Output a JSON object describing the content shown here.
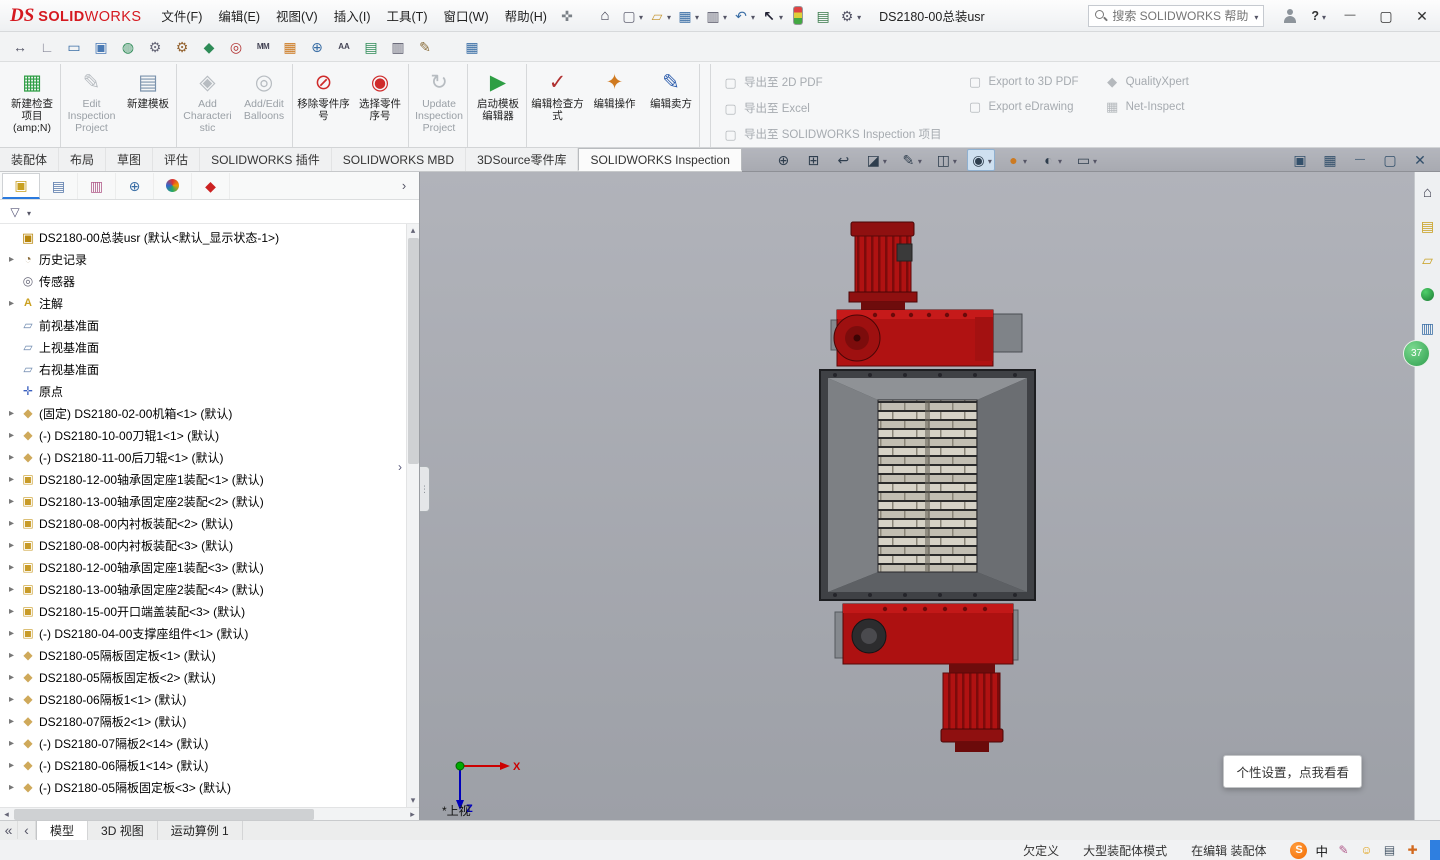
{
  "titlebar": {
    "brand": {
      "logo_text": "DS",
      "name_strong": "SOLID",
      "name_light": "WORKS"
    },
    "menus": [
      {
        "label": "文件(F)"
      },
      {
        "label": "编辑(E)"
      },
      {
        "label": "视图(V)"
      },
      {
        "label": "插入(I)"
      },
      {
        "label": "工具(T)"
      },
      {
        "label": "窗口(W)"
      },
      {
        "label": "帮助(H)"
      }
    ],
    "doc_title": "DS2180-00总装usr",
    "search_placeholder": "搜索 SOLIDWORKS 帮助",
    "help_label": "?"
  },
  "qat": {
    "items": [
      {
        "icon": "home-icon"
      },
      {
        "icon": "new-document-icon",
        "dropdown": true
      },
      {
        "icon": "open-icon",
        "dropdown": true
      },
      {
        "icon": "save-icon",
        "dropdown": true
      },
      {
        "icon": "print-icon",
        "dropdown": true
      },
      {
        "icon": "undo-icon",
        "dropdown": true
      },
      {
        "icon": "select-arrow-icon",
        "dropdown": true
      },
      {
        "icon": "performance-icon"
      },
      {
        "icon": "task-list-icon"
      },
      {
        "icon": "options-icon",
        "dropdown": true
      }
    ]
  },
  "window_controls": {
    "items": [
      {
        "icon": "minimize-icon"
      },
      {
        "icon": "maximize-icon"
      },
      {
        "icon": "close-icon"
      }
    ]
  },
  "toolbar2": {
    "items": [
      {
        "icon": "callout-icon"
      },
      {
        "icon": "ruler-icon"
      },
      {
        "icon": "monitor-icon"
      },
      {
        "icon": "capture-icon"
      },
      {
        "icon": "globe-icon"
      },
      {
        "icon": "gear-icon"
      },
      {
        "icon": "addins-gear-icon"
      },
      {
        "icon": "shield-icon"
      },
      {
        "icon": "target-icon"
      },
      {
        "icon": "units-icon"
      },
      {
        "icon": "palette-icon"
      },
      {
        "icon": "zoom-tool-icon"
      },
      {
        "icon": "fonts-icon"
      },
      {
        "icon": "doc-export-icon"
      },
      {
        "icon": "printer-icon"
      },
      {
        "icon": "doc-edit-icon"
      },
      {
        "icon": "grid-icon",
        "gap": true
      }
    ]
  },
  "ribbon": {
    "buttons": [
      {
        "label": "新建检查项目(amp;N)",
        "icon": "new-inspection-project-icon",
        "enabled": true,
        "sep": true
      },
      {
        "label": "Edit Inspection Project",
        "icon": "edit-inspection-project-icon",
        "enabled": false
      },
      {
        "label": "新建模板",
        "icon": "new-template-icon",
        "enabled": true,
        "sep": true
      },
      {
        "label": "Add Characteristic",
        "icon": "add-characteristic-icon",
        "enabled": false
      },
      {
        "label": "Add/Edit Balloons",
        "icon": "add-edit-balloons-icon",
        "enabled": false,
        "sep": true
      },
      {
        "label": "移除零件序号",
        "icon": "remove-balloons-icon",
        "enabled": true
      },
      {
        "label": "选择零件序号",
        "icon": "select-balloons-icon",
        "enabled": true,
        "sep": true
      },
      {
        "label": "Update Inspection Project",
        "icon": "update-inspection-project-icon",
        "enabled": false,
        "sep": true
      },
      {
        "label": "启动模板编辑器",
        "icon": "launch-template-editor-icon",
        "enabled": true,
        "sep": true
      },
      {
        "label": "编辑检查方式",
        "icon": "edit-inspection-method-icon",
        "enabled": true
      },
      {
        "label": "编辑操作",
        "icon": "edit-operation-icon",
        "enabled": true
      },
      {
        "label": "编辑卖方",
        "icon": "edit-vendor-icon",
        "enabled": true,
        "sep": true
      }
    ],
    "export_col1": [
      {
        "label": "导出至 2D PDF",
        "icon": "export-2d-pdf-icon"
      },
      {
        "label": "导出至 Excel",
        "icon": "export-excel-icon"
      },
      {
        "label": "导出至 SOLIDWORKS Inspection 项目",
        "icon": "export-inspection-project-icon"
      }
    ],
    "export_col2": [
      {
        "label": "Export to 3D PDF",
        "icon": "export-3d-pdf-icon"
      },
      {
        "label": "Export eDrawing",
        "icon": "export-edrawing-icon"
      }
    ],
    "export_col3": [
      {
        "label": "QualityXpert",
        "icon": "qualityxpert-icon"
      },
      {
        "label": "Net-Inspect",
        "icon": "net-inspect-icon"
      }
    ]
  },
  "command_tabs": {
    "items": [
      {
        "label": "装配体"
      },
      {
        "label": "布局"
      },
      {
        "label": "草图"
      },
      {
        "label": "评估"
      },
      {
        "label": "SOLIDWORKS 插件"
      },
      {
        "label": "SOLIDWORKS MBD"
      },
      {
        "label": "3DSource零件库"
      },
      {
        "label": "SOLIDWORKS Inspection",
        "active": true
      }
    ]
  },
  "headsup": {
    "items": [
      {
        "icon": "zoom-fit-icon"
      },
      {
        "icon": "zoom-area-icon"
      },
      {
        "icon": "previous-view-icon"
      },
      {
        "icon": "section-view-icon",
        "dropdown": true
      },
      {
        "icon": "annotation-view-icon",
        "dropdown": true
      },
      {
        "icon": "display-style-icon",
        "dropdown": true
      },
      {
        "icon": "hide-show-icon",
        "dropdown": true,
        "active": true
      },
      {
        "icon": "appearances-icon",
        "dropdown": true
      },
      {
        "icon": "scene-icon",
        "dropdown": true
      },
      {
        "icon": "view-settings-icon",
        "dropdown": true
      }
    ]
  },
  "doc_controls": {
    "items": [
      {
        "icon": "cascade-icon"
      },
      {
        "icon": "tile-icon"
      },
      {
        "icon": "minimize-doc-icon"
      },
      {
        "icon": "restore-doc-icon"
      },
      {
        "icon": "close-doc-icon"
      }
    ]
  },
  "panel": {
    "tabs": [
      {
        "icon": "featuremanager-icon",
        "active": true
      },
      {
        "icon": "propertymanager-icon"
      },
      {
        "icon": "configurationmanager-icon"
      },
      {
        "icon": "dimxpertmanager-icon"
      },
      {
        "icon": "displaymanager-icon"
      },
      {
        "icon": "inspectionmanager-icon"
      }
    ],
    "root_label": "DS2180-00总装usr  (默认<默认_显示状态-1>)",
    "items": [
      {
        "arrow": true,
        "icon": "history-icon",
        "label": "历史记录"
      },
      {
        "arrow": false,
        "icon": "sensors-icon",
        "label": "传感器"
      },
      {
        "arrow": true,
        "icon": "annotations-icon",
        "label": "注解"
      },
      {
        "arrow": false,
        "icon": "plane-icon",
        "label": "前视基准面"
      },
      {
        "arrow": false,
        "icon": "plane-icon",
        "label": "上视基准面"
      },
      {
        "arrow": false,
        "icon": "plane-icon",
        "label": "右视基准面"
      },
      {
        "arrow": false,
        "icon": "origin-icon",
        "label": "原点"
      },
      {
        "arrow": true,
        "icon": "part-icon",
        "label": "(固定) DS2180-02-00机箱<1> (默认)"
      },
      {
        "arrow": true,
        "icon": "part-icon",
        "label": "(-) DS2180-10-00刀辊1<1> (默认)"
      },
      {
        "arrow": true,
        "icon": "part-icon",
        "label": "(-) DS2180-11-00后刀辊<1> (默认)"
      },
      {
        "arrow": true,
        "icon": "assembly-icon",
        "label": "DS2180-12-00轴承固定座1装配<1> (默认)"
      },
      {
        "arrow": true,
        "icon": "assembly-icon",
        "label": "DS2180-13-00轴承固定座2装配<2> (默认)"
      },
      {
        "arrow": true,
        "icon": "assembly-icon",
        "label": "DS2180-08-00内衬板装配<2> (默认)"
      },
      {
        "arrow": true,
        "icon": "assembly-icon",
        "label": "DS2180-08-00内衬板装配<3> (默认)"
      },
      {
        "arrow": true,
        "icon": "assembly-icon",
        "label": "DS2180-12-00轴承固定座1装配<3> (默认)"
      },
      {
        "arrow": true,
        "icon": "assembly-icon",
        "label": "DS2180-13-00轴承固定座2装配<4> (默认)"
      },
      {
        "arrow": true,
        "icon": "assembly-icon",
        "label": "DS2180-15-00开口端盖装配<3> (默认)"
      },
      {
        "arrow": true,
        "icon": "assembly-icon",
        "label": "(-) DS2180-04-00支撑座组件<1> (默认)"
      },
      {
        "arrow": true,
        "icon": "part-icon",
        "label": "DS2180-05隔板固定板<1> (默认)"
      },
      {
        "arrow": true,
        "icon": "part-icon",
        "label": "DS2180-05隔板固定板<2> (默认)"
      },
      {
        "arrow": true,
        "icon": "part-icon",
        "label": "DS2180-06隔板1<1> (默认)"
      },
      {
        "arrow": true,
        "icon": "part-icon",
        "label": "DS2180-07隔板2<1> (默认)"
      },
      {
        "arrow": true,
        "icon": "part-icon",
        "label": "(-) DS2180-07隔板2<14> (默认)"
      },
      {
        "arrow": true,
        "icon": "part-icon",
        "label": "(-) DS2180-06隔板1<14> (默认)"
      },
      {
        "arrow": true,
        "icon": "part-icon",
        "label": "(-) DS2180-05隔板固定板<3> (默认)"
      }
    ]
  },
  "viewport": {
    "view_label": "*上视",
    "axis_x": "X",
    "axis_z": "Z"
  },
  "taskpane": {
    "items": [
      {
        "icon": "home-icon"
      },
      {
        "icon": "design-library-icon"
      },
      {
        "icon": "file-explorer-icon"
      },
      {
        "icon": "marketplace-icon"
      },
      {
        "icon": "view-palette-icon"
      }
    ],
    "badge": "37"
  },
  "bottom_tabs": {
    "items": [
      {
        "label": "模型",
        "active": true
      },
      {
        "label": "3D 视图"
      },
      {
        "label": "运动算例 1"
      }
    ]
  },
  "statusbar": {
    "definition": "欠定义",
    "mode": "大型装配体模式",
    "editing": "在编辑 装配体",
    "ime": {
      "sogou": "S",
      "lang": "中"
    }
  },
  "tooltip": {
    "text": "个性设置，点我看看"
  }
}
